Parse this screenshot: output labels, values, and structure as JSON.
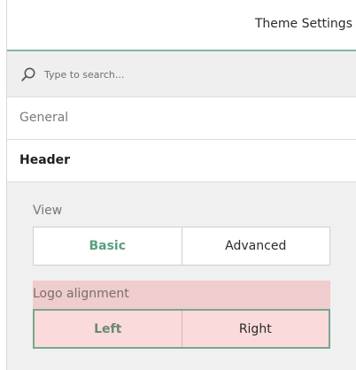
{
  "header": {
    "title": "Theme Settings"
  },
  "search": {
    "placeholder": "Type to search...",
    "icon": "search-icon"
  },
  "nav": {
    "items": [
      {
        "label": "General",
        "active": false
      },
      {
        "label": "Header",
        "active": true
      }
    ]
  },
  "view": {
    "label": "View",
    "options": [
      "Basic",
      "Advanced"
    ],
    "selected": "Basic"
  },
  "logo_alignment": {
    "label": "Logo alignment",
    "options": [
      "Left",
      "Right"
    ],
    "selected": "Left"
  },
  "colors": {
    "accent": "#5a9f80",
    "header_border": "#7fb7a0",
    "highlight_label": "#efcccd",
    "highlight_segment": "#fadadb",
    "focus_border": "#78a68e"
  }
}
